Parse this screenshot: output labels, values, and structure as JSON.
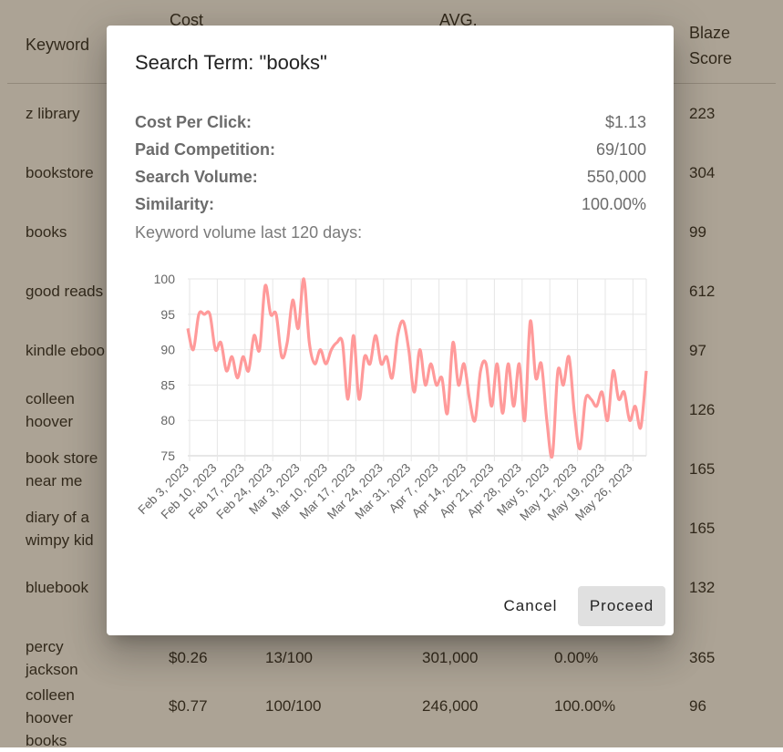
{
  "table": {
    "headers": {
      "keyword": "Keyword",
      "cost": "Cost",
      "avg": "AVG.",
      "blaze": "Blaze Score"
    },
    "rows": [
      {
        "keyword": "z library",
        "blaze": "223"
      },
      {
        "keyword": "bookstore",
        "blaze": "304"
      },
      {
        "keyword": "books",
        "blaze": "99"
      },
      {
        "keyword": "good reads",
        "blaze": "612"
      },
      {
        "keyword": "kindle eboo",
        "blaze": "97"
      },
      {
        "keyword": "colleen hoover",
        "blaze": "126"
      },
      {
        "keyword": "book store near me",
        "blaze": "165"
      },
      {
        "keyword": "diary of a wimpy kid",
        "blaze": "165"
      },
      {
        "keyword": "bluebook",
        "blaze": "132"
      },
      {
        "keyword": "percy jackson",
        "cpc": "$0.26",
        "competition": "13/100",
        "volume": "301,000",
        "similarity": "0.00%",
        "blaze": "365"
      },
      {
        "keyword": "colleen hoover books",
        "cpc": "$0.77",
        "competition": "100/100",
        "volume": "246,000",
        "similarity": "100.00%",
        "blaze": "96"
      }
    ]
  },
  "dialog": {
    "title": "Search Term: \"books\"",
    "stats": [
      {
        "label": "Cost Per Click:",
        "value": "$1.13"
      },
      {
        "label": "Paid Competition:",
        "value": "69/100"
      },
      {
        "label": "Search Volume:",
        "value": "550,000"
      },
      {
        "label": "Similarity:",
        "value": "100.00%"
      }
    ],
    "chart_caption": "Keyword volume last 120 days:",
    "cancel_label": "Cancel",
    "proceed_label": "Proceed"
  },
  "colors": {
    "line": "#ff9a9a",
    "grid": "#e6e6e6",
    "overlay": "rgba(70,50,20,0.45)",
    "proceed_bg": "#e0e0e0"
  },
  "chart_data": {
    "type": "line",
    "title": "",
    "xlabel": "",
    "ylabel": "",
    "ylim": [
      75,
      100
    ],
    "yticks": [
      75,
      80,
      85,
      90,
      95,
      100
    ],
    "grid": true,
    "x_ticks": [
      "Feb 3, 2023",
      "Feb 10, 2023",
      "Feb 17, 2023",
      "Feb 24, 2023",
      "Mar 3, 2023",
      "Mar 10, 2023",
      "Mar 17, 2023",
      "Mar 24, 2023",
      "Mar 31, 2023",
      "Apr 7, 2023",
      "Apr 14, 2023",
      "Apr 21, 2023",
      "Apr 28, 2023",
      "May 5, 2023",
      "May 12, 2023",
      "May 19, 2023",
      "May 26, 2023"
    ],
    "series": [
      {
        "values": [
          93,
          90,
          95,
          95,
          95,
          90,
          91,
          87,
          89,
          86,
          89,
          87,
          92,
          90,
          99,
          95,
          95,
          89,
          91,
          97,
          93,
          100,
          91,
          88,
          90,
          88,
          90,
          91,
          91,
          83,
          92,
          83,
          89,
          88,
          92,
          88,
          89,
          86,
          92,
          94,
          90,
          84,
          90,
          85,
          88,
          85,
          86,
          81,
          91,
          85,
          88,
          83,
          80,
          87,
          88,
          82,
          88,
          81,
          88,
          82,
          88,
          80,
          94,
          86,
          88,
          80,
          75,
          87,
          85,
          89,
          81,
          76,
          83,
          83,
          82,
          84,
          80,
          87,
          83,
          84,
          80,
          82,
          79,
          87
        ]
      }
    ]
  }
}
